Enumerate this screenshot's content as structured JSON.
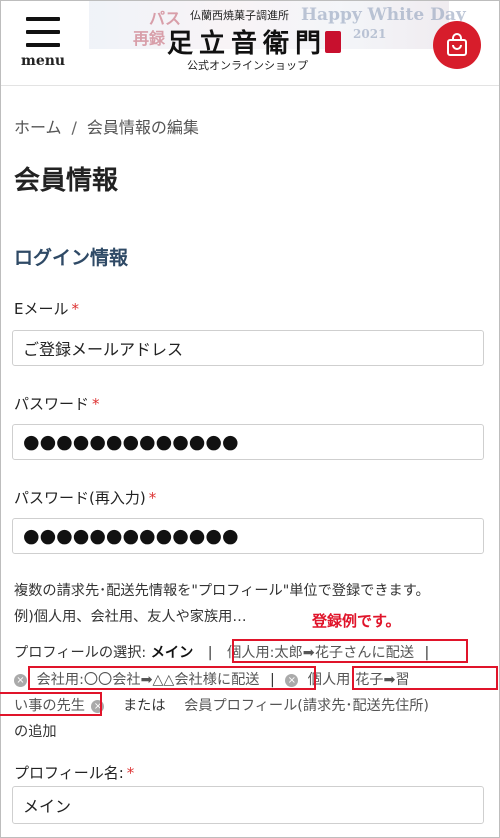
{
  "header": {
    "menu_label": "menu",
    "logo_subtitle": "仏蘭西焼菓子調進所",
    "logo_title": "足立音衛門",
    "logo_footer": "公式オンラインショップ",
    "banner_left": "パス",
    "banner_left2": "再録",
    "banner_right": "Happy White Day",
    "banner_year": "2021"
  },
  "breadcrumb": {
    "home": "ホーム",
    "separator": "/",
    "current": "会員情報の編集"
  },
  "page_title": "会員情報",
  "login_section": {
    "title": "ログイン情報",
    "email_label": "Eメール",
    "email_value": "ご登録メールアドレス",
    "password_label": "パスワード",
    "password_value": "●●●●●●●●●●●●●",
    "password_confirm_label": "パスワード(再入力)",
    "password_confirm_value": "●●●●●●●●●●●●●",
    "required_mark": "*"
  },
  "profile": {
    "note_line1": "複数の請求先･配送先情報を\"プロフィール\"単位で登録できます。",
    "note_line2": "例)個人用、会社用、友人や家族用…",
    "example_label": "登録例です。",
    "select_label": "プロフィールの選択:",
    "current": "メイン",
    "divider": "|",
    "items": [
      "個人用:太郎➡花子さんに配送",
      "会社用:〇〇会社➡△△会社様に配送",
      "個人用:花子➡習",
      "い事の先生"
    ],
    "or_text": "または",
    "add_link": "会員プロフィール(請求先･配送先住所)",
    "add_suffix": "の追加",
    "name_label": "プロフィール名:",
    "name_value": "メイン",
    "delete_icon": "×"
  },
  "colors": {
    "accent_red": "#e0142a",
    "cart_red": "#d71d2b",
    "section_blue": "#2f4a66"
  }
}
